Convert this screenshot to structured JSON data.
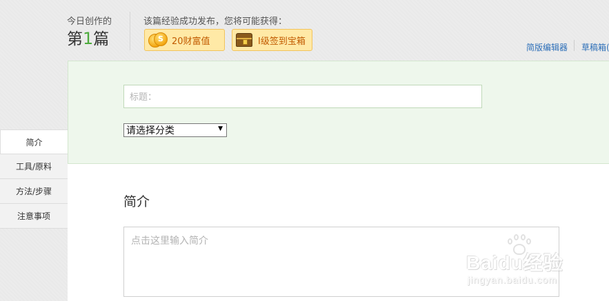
{
  "header": {
    "today_label": "今日创作的",
    "count_prefix": "第",
    "count_value": "1",
    "count_suffix": "篇",
    "reward_label": "该篇经验成功发布，您将可能获得：",
    "badges": [
      {
        "icon": "coin-icon",
        "amount": "20",
        "label": "财富值"
      },
      {
        "icon": "treasure-chest-icon",
        "amount": "I级",
        "label": "签到宝箱"
      }
    ],
    "links": {
      "simple_editor": "简版编辑器",
      "drafts": "草稿箱("
    }
  },
  "form": {
    "title_placeholder": "标题：",
    "category_selected": "请选择分类"
  },
  "sidebar": {
    "items": [
      {
        "label": "简介",
        "active": true
      },
      {
        "label": "工具/原料",
        "active": false
      },
      {
        "label": "方法/步骤",
        "active": false
      },
      {
        "label": "注意事项",
        "active": false
      }
    ]
  },
  "intro": {
    "heading": "简介",
    "placeholder": "点击这里输入简介"
  },
  "watermark": {
    "logo": "Baidu经验",
    "url": "jingyan.baidu.com"
  },
  "colors": {
    "accent_green": "#4caa3c",
    "link_blue": "#2d6fb8",
    "badge_fill": "#ffe9a6",
    "panel_green": "#eef7ec"
  }
}
